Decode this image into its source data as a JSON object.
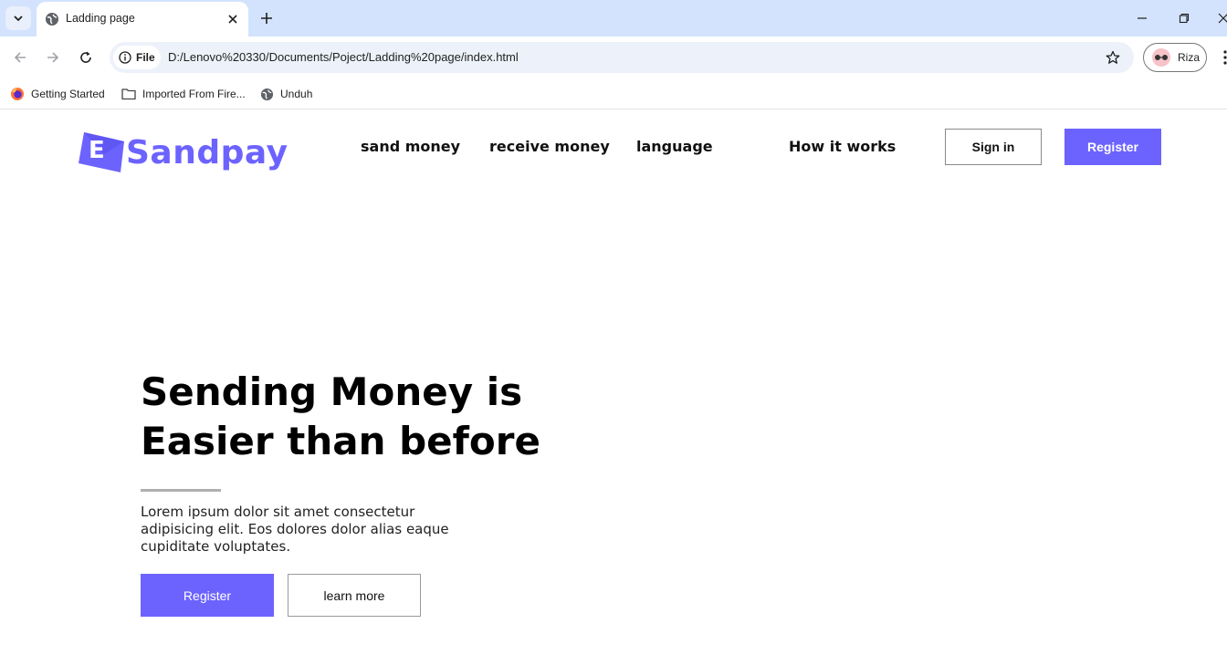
{
  "browser": {
    "tab": {
      "title": "Ladding page"
    },
    "address_bar": {
      "site_chip": "File",
      "url": "D:/Lenovo%20330/Documents/Poject/Ladding%20page/index.html"
    },
    "profile": {
      "name": "Riza"
    },
    "bookmarks": [
      {
        "label": "Getting Started",
        "icon": "firefox-icon"
      },
      {
        "label": "Imported From Fire...",
        "icon": "folder-icon"
      },
      {
        "label": "Unduh",
        "icon": "globe-icon"
      }
    ]
  },
  "site": {
    "logo": {
      "letter": "E",
      "text": "Sandpay"
    },
    "nav": [
      "sand money",
      "receive money",
      "language",
      "How it works"
    ],
    "header_buttons": {
      "signin": "Sign in",
      "register": "Register"
    }
  },
  "hero": {
    "title": "Sending Money is Easier than before",
    "text": "Lorem ipsum dolor sit amet consectetur adipisicing elit. Eos dolores dolor alias eaque cupiditate voluptates.",
    "buttons": {
      "register": "Register",
      "learn_more": "learn more"
    }
  },
  "colors": {
    "accent": "#6c63ff",
    "tabstrip": "#d3e3fd",
    "omnibox": "#edf2fa"
  }
}
